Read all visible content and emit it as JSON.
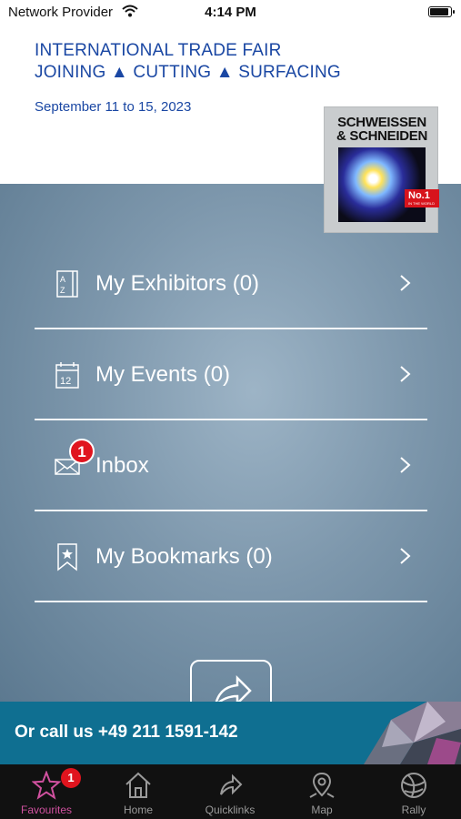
{
  "status_bar": {
    "carrier": "Network Provider",
    "time": "4:14 PM",
    "battery_level": 0.9
  },
  "header": {
    "line1": "INTERNATIONAL TRADE FAIR",
    "line2": "JOINING ▲ CUTTING ▲ SURFACING",
    "dates": "September 11 to 15, 2023"
  },
  "logo": {
    "title_line1": "SCHWEISSEN",
    "title_line2": "& SCHNEIDEN",
    "badge_main": "No.1",
    "badge_sub": "IN THE WORLD"
  },
  "menu": [
    {
      "label": "My Exhibitors (0)",
      "icon": "az-book-icon"
    },
    {
      "label": "My Events (0)",
      "icon": "calendar-12-icon"
    },
    {
      "label": "Inbox",
      "icon": "envelope-icon",
      "badge": "1"
    },
    {
      "label": "My Bookmarks (0)",
      "icon": "bookmark-star-icon"
    }
  ],
  "call_banner": {
    "text": "Or call us +49 211 1591-142"
  },
  "tabs": [
    {
      "label": "Favourites",
      "icon": "star-icon",
      "active": true,
      "badge": "1"
    },
    {
      "label": "Home",
      "icon": "home-icon"
    },
    {
      "label": "Quicklinks",
      "icon": "share-arrow-icon"
    },
    {
      "label": "Map",
      "icon": "map-pin-icon"
    },
    {
      "label": "Rally",
      "icon": "globe-icon"
    }
  ],
  "colors": {
    "header_text": "#1a47a3",
    "main_bg": "#7d97ac",
    "banner_bg": "#0f6f91",
    "active_tab": "#d0519f",
    "badge": "#e0141e"
  }
}
